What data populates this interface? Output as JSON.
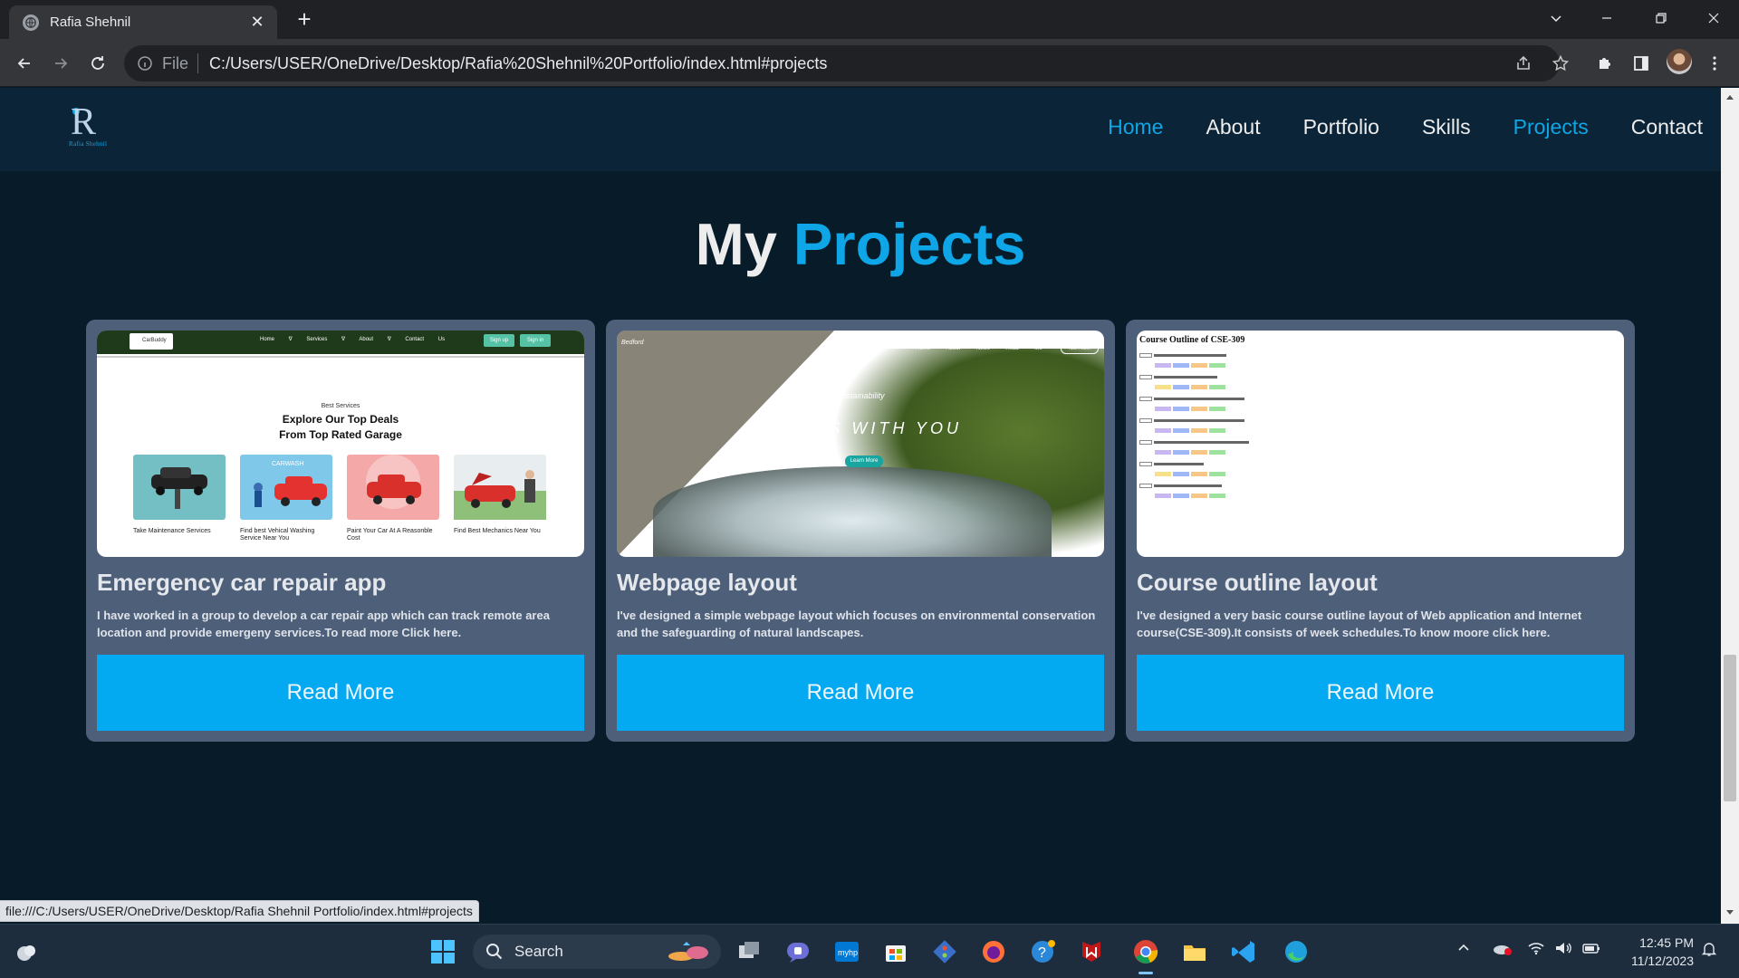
{
  "browser": {
    "tab_title": "Rafia Shehnil",
    "file_label": "File",
    "url": "C:/Users/USER/OneDrive/Desktop/Rafia%20Shehnil%20Portfolio/index.html#projects",
    "status_url": "file:///C:/Users/USER/OneDrive/Desktop/Rafia Shehnil Portfolio/index.html#projects"
  },
  "site": {
    "logo_letter": "R",
    "logo_signature": "Rafia Shehnil",
    "nav": [
      {
        "label": "Home",
        "active": true
      },
      {
        "label": "About",
        "active": false
      },
      {
        "label": "Portfolio",
        "active": false
      },
      {
        "label": "Skills",
        "active": false
      },
      {
        "label": "Projects",
        "active": true
      },
      {
        "label": "Contact",
        "active": false
      }
    ],
    "section_title_plain": "My",
    "section_title_accent": "Projects"
  },
  "projects": [
    {
      "title": "Emergency car repair app",
      "description": "I have worked in a group to develop a car repair app which can track remote area location and provide emergeny services.To read more Click here.",
      "button": "Read More",
      "thumb": {
        "brand": "CarBuddy",
        "links": "Home  ∇ Services  ∇ About  ∇ Contact Us",
        "signup": "Sign up",
        "signin": "Sign in",
        "eyebrow": "Best Services",
        "headline_1": "Explore Our Top Deals",
        "headline_2": "From Top Rated Garage",
        "carwash_label": "CARWASH",
        "services": [
          "Take Maintenance Services",
          "Find best Vehical Washing Service Near You",
          "Paint Your Car At A Reasonble Cost",
          "Find Best Mechanics Near You"
        ]
      }
    },
    {
      "title": "Webpage layout",
      "description": "I've designed a simple webpage layout which focuses on environmental conservation and the safeguarding of natural landscapes.",
      "button": "Read More",
      "thumb": {
        "brand": "Bedford",
        "links": "Home About News Read Me",
        "cta": "Take Action",
        "kicker": "Sustainability",
        "headline": "STARTS WITH YOU",
        "learn": "Learn More"
      }
    },
    {
      "title": "Course outline layout",
      "description": "I've designed a very basic course outline layout of Web application and Internet course(CSE-309).It consists of week schedules.To know moore click here.",
      "button": "Read More",
      "thumb": {
        "heading": "Course Outline of CSE-309"
      }
    }
  ],
  "taskbar": {
    "search_label": "Search",
    "time": "12:45 PM",
    "date": "11/12/2023"
  },
  "colors": {
    "accent": "#0ea6e6",
    "page_bg": "#081b29",
    "card_bg": "#4e5f7a",
    "button_bg": "#03a9f1"
  }
}
